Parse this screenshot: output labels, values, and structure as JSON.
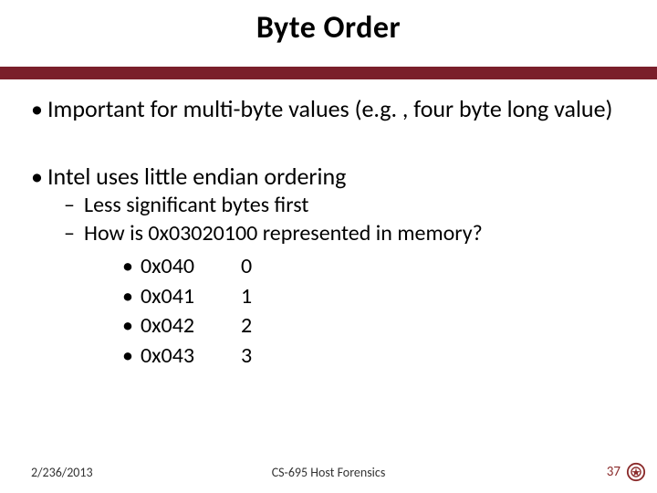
{
  "title": "Byte Order",
  "bullets": {
    "b1a": "Important for multi-byte values (e.g. , four byte long value)",
    "b1b": "Intel uses little endian ordering",
    "b2a": "Less significant bytes first",
    "b2b": "How is 0x03020100 represented in memory?",
    "rows": [
      {
        "addr": "0x040",
        "val": "0"
      },
      {
        "addr": "0x041",
        "val": "1"
      },
      {
        "addr": "0x042",
        "val": "2"
      },
      {
        "addr": "0x043",
        "val": "3"
      }
    ]
  },
  "footer": {
    "date": "2/236/2013",
    "course": "CS-695 Host Forensics",
    "page": "37"
  },
  "colors": {
    "rule": "#7a1f2b",
    "pagenum": "#8a2a2a"
  }
}
